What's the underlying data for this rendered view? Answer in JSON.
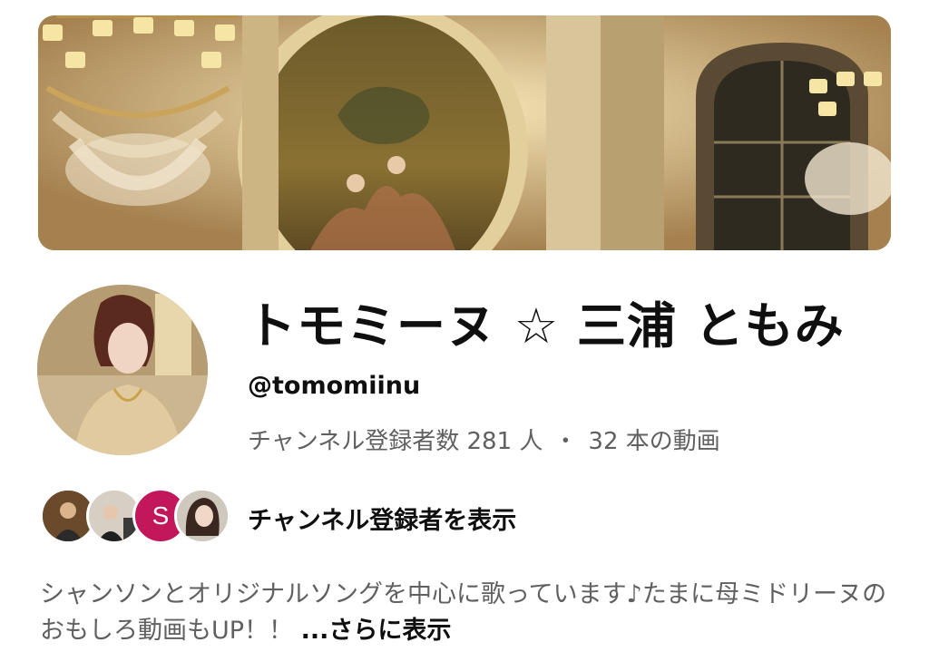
{
  "channel": {
    "name": "トモミーヌ ☆ 三浦 ともみ",
    "handle": "@tomomiinu",
    "subscribers": "チャンネル登録者数 281 人",
    "separator": "・",
    "videos": "32 本の動画"
  },
  "subscribers_row": {
    "link_label": "チャンネル登録者を表示",
    "avatars": [
      {
        "icon": "subscriber-photo"
      },
      {
        "icon": "subscriber-photo"
      },
      {
        "letter": "S",
        "color": "#c2185b"
      },
      {
        "icon": "subscriber-photo"
      }
    ]
  },
  "description": {
    "text": "シャンソンとオリジナルソングを中心に歌っています♪たまに母ミドリーヌのおもしろ動画もUP！！",
    "more_label": "...さらに表示"
  },
  "colors": {
    "primary_text": "#0f0f0f",
    "secondary_text": "#606060",
    "subscriber_s_badge": "#c2185b"
  }
}
